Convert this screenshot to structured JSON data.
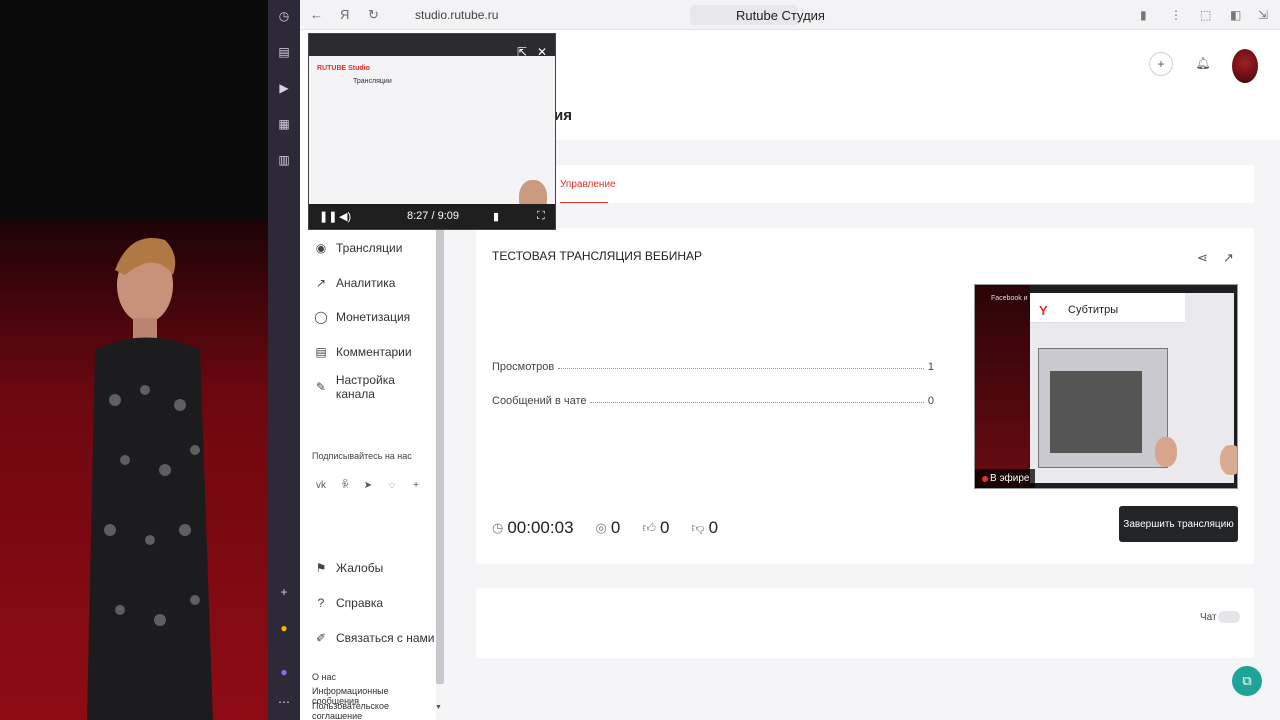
{
  "browser": {
    "url": "studio.rutube.ru",
    "tab_title": "Rutube Студия"
  },
  "header": {
    "title_partial": "ия"
  },
  "sidebar": {
    "items": [
      {
        "label": "Трансляции",
        "icon": "broadcast-icon"
      },
      {
        "label": "Аналитика",
        "icon": "analytics-icon"
      },
      {
        "label": "Монетизация",
        "icon": "monetization-icon"
      },
      {
        "label": "Комментарии",
        "icon": "comments-icon"
      },
      {
        "label": "Настройка канала",
        "icon": "channel-settings-icon"
      }
    ],
    "subscribe_title": "Подписывайтесь на нас",
    "social": [
      "vk-icon",
      "ok-icon",
      "telegram-icon",
      "viber-icon",
      "more-icon"
    ],
    "bottom_items": [
      {
        "label": "Жалобы",
        "icon": "flag-icon"
      },
      {
        "label": "Справка",
        "icon": "help-icon"
      },
      {
        "label": "Связаться с нами",
        "icon": "contact-icon"
      }
    ],
    "footer_links": [
      "О нас",
      "Информационные сообщения",
      "Пользовательское соглашение"
    ]
  },
  "tabs": {
    "active": "Управление"
  },
  "stream": {
    "title": "ТЕСТОВАЯ ТРАНСЛЯЦИЯ ВЕБИНАР",
    "views_label": "Просмотров",
    "views_value": "1",
    "chat_messages_label": "Сообщений в чате",
    "chat_messages_value": "0",
    "duration": "00:00:03",
    "viewers": "0",
    "likes": "0",
    "dislikes": "0",
    "end_button": "Завершить трансляцию",
    "live_badge": "В эфире",
    "preview_subtitles": "Субтитры",
    "preview_topline": "Facebook и Insta"
  },
  "chat": {
    "label": "Чат"
  },
  "pip": {
    "time": "8:27 / 9:09",
    "logo": "RUTUBE Studio",
    "page_title": "Трансляции"
  },
  "colors": {
    "accent": "#e0312b",
    "button_dark": "#222428",
    "fab": "#1fa597"
  }
}
